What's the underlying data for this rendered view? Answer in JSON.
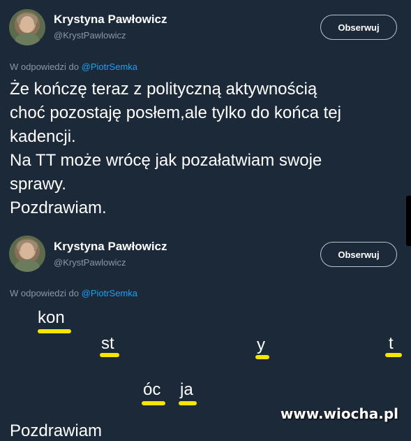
{
  "colors": {
    "background": "#1c2938",
    "secondary_text": "#8899a6",
    "link": "#1da1f2",
    "highlight": "#f5e500"
  },
  "tweet1": {
    "name": "Krystyna Pawłowicz",
    "handle": "@KrystPawlowicz",
    "follow_label": "Obserwuj",
    "reply_prefix": "W odpowiedzi do ",
    "reply_mention": "@PiotrSemka",
    "lines": [
      "Że kończę teraz z polityczną aktywnością",
      "choć pozostaję posłem,ale tylko do końca tej",
      "kadencji.",
      "Na TT może wrócę jak pozałatwiam swoje",
      "sprawy.",
      "Pozdrawiam."
    ]
  },
  "tweet2": {
    "name": "Krystyna Pawłowicz",
    "handle": "@KrystPawlowicz",
    "follow_label": "Obserwuj",
    "reply_prefix": "W odpowiedzi do ",
    "reply_mention": "@PiotrSemka",
    "fragments": [
      "kon",
      "st",
      "y",
      "t",
      "óc",
      "ja"
    ],
    "cut_text": "Pozdrawiam"
  },
  "watermark": "www.wiocha.pl"
}
